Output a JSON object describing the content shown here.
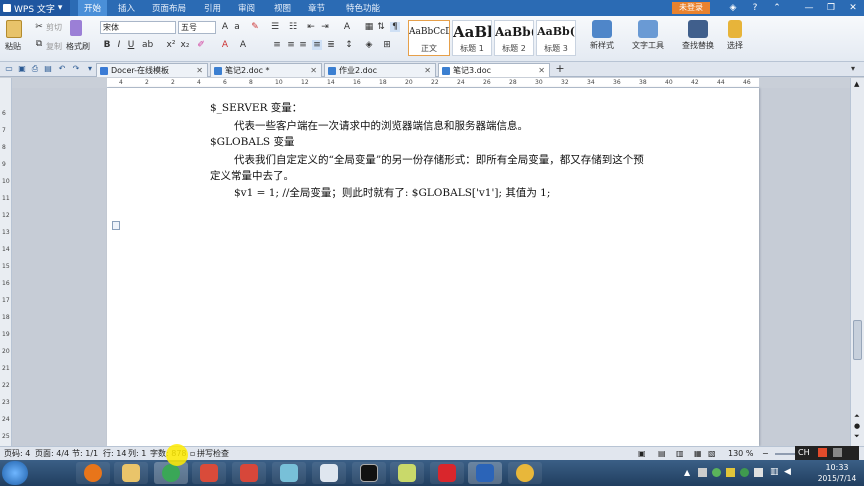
{
  "app": {
    "name": "WPS 文字",
    "login_label": "未登录"
  },
  "menus": [
    "开始",
    "插入",
    "页面布局",
    "引用",
    "审阅",
    "视图",
    "章节",
    "特色功能"
  ],
  "ribbon": {
    "paste": "粘贴",
    "cut": "剪切",
    "copy": "复制",
    "format_painter": "格式刷",
    "font_name": "宋体",
    "font_size": "五号",
    "styles": [
      {
        "sample": "AaBbCcDd",
        "name": "正文"
      },
      {
        "sample": "AaBl",
        "name": "标题 1"
      },
      {
        "sample": "AaBb(",
        "name": "标题 2"
      },
      {
        "sample": "AaBb(",
        "name": "标题 3"
      }
    ],
    "new_style": "新样式",
    "text_tools": "文字工具",
    "find_replace": "查找替换",
    "select": "选择"
  },
  "tabs": [
    {
      "label": "Docer-在线模板",
      "active": false
    },
    {
      "label": "笔记2.doc *",
      "active": false
    },
    {
      "label": "作业2.doc",
      "active": false
    },
    {
      "label": "笔记3.doc",
      "active": true
    }
  ],
  "ruler": {
    "h_ticks": [
      "4",
      "2",
      "2",
      "4",
      "6",
      "8",
      "10",
      "12",
      "14",
      "16",
      "18",
      "20",
      "22",
      "24",
      "26",
      "28",
      "30",
      "32",
      "34",
      "36",
      "38",
      "40",
      "42",
      "44",
      "46"
    ],
    "v_ticks": [
      "6",
      "7",
      "8",
      "9",
      "10",
      "11",
      "12",
      "13",
      "14",
      "15",
      "16",
      "17",
      "18",
      "19",
      "20",
      "21",
      "22",
      "23",
      "24",
      "25",
      "26"
    ]
  },
  "document": {
    "lines": [
      "$_SERVER 变量：",
      "代表一些客户端在一次请求中的浏览器端信息和服务器端信息。",
      "$GLOBALS 变量",
      "代表我们自定定义的“全局变量”的另一份存储形式：即所有全局变量，都又存储到这个预",
      "定义常量中去了。",
      "$v1 = 1;  //全局变量；则此时就有了: $GLOBALS['v1']; 其值为 1;"
    ]
  },
  "statusbar": {
    "page": "页码: 4",
    "pages": "页面: 4/4",
    "section": "节: 1/1",
    "row": "行: 14",
    "col": "列: 1",
    "words": "字数: 878",
    "spell": "拼写检查",
    "zoom": "130 %"
  },
  "tray": {
    "ime": "CH",
    "time": "10:33",
    "date": "2015/7/14"
  }
}
